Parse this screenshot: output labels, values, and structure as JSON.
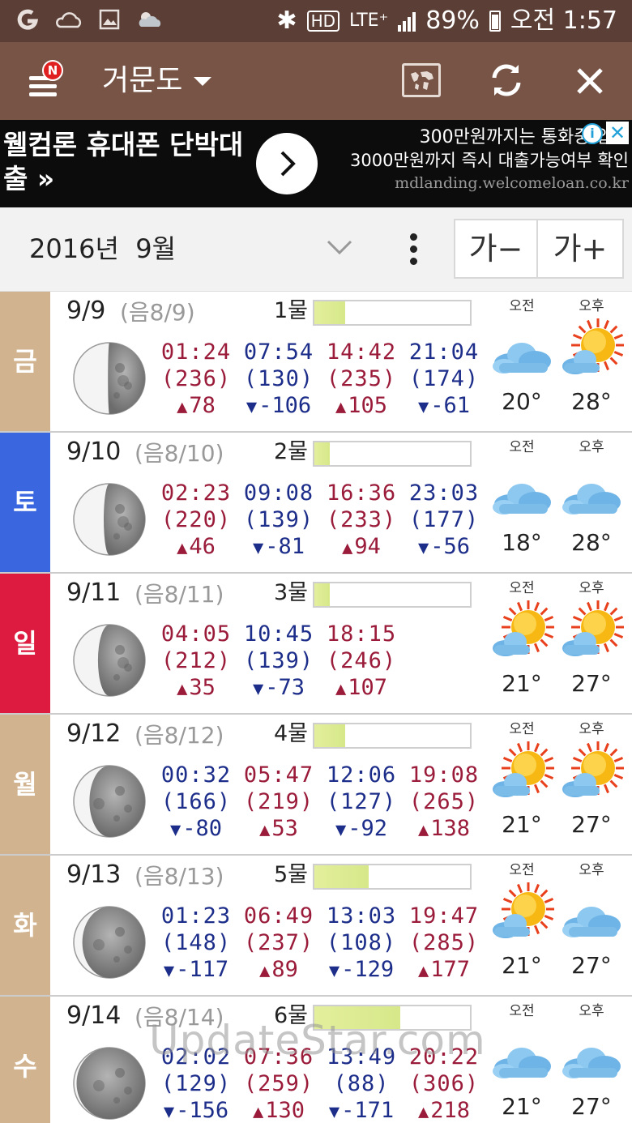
{
  "status_bar": {
    "left_icons": [
      "g-icon",
      "cloud-outline-icon",
      "image-icon",
      "weather-icon"
    ],
    "bluetooth": "✱",
    "hd": "HD",
    "network": "LTE⁺",
    "battery_percent": "89%",
    "time": "오전 1:57"
  },
  "app_bar": {
    "badge": "N",
    "location": "거문도"
  },
  "ad": {
    "left_text": "웰컴론 휴대폰 단박대출 »",
    "right_line1": "300만원까지는 통화중 입금",
    "right_line2": "3000만원까지 즉시 대출가능여부 확인",
    "right_url": "mdlanding.welcomeloan.co.kr",
    "info": "i",
    "close": "✕"
  },
  "month_bar": {
    "label": "2016년  9월",
    "font_minus": "가−",
    "font_plus": "가+"
  },
  "labels": {
    "am": "오전",
    "pm": "오후"
  },
  "colors": {
    "dow_weekday": "#d2b38f",
    "dow_saturday": "#3a67e0",
    "dow_sunday": "#dd1a3f",
    "high_tide": "#9a1c3a",
    "low_tide": "#1d2e8a"
  },
  "days": [
    {
      "dow": "금",
      "date": "9/9",
      "lunar": "(음8/9)",
      "mul": "1물",
      "tide_level": 0.2,
      "moon_phase": "waxing-crescent",
      "tides": [
        {
          "time": "01:24",
          "height": "(236)",
          "diff": "78",
          "type": "high"
        },
        {
          "time": "07:54",
          "height": "(130)",
          "diff": "-106",
          "type": "low"
        },
        {
          "time": "14:42",
          "height": "(235)",
          "diff": "105",
          "type": "high"
        },
        {
          "time": "21:04",
          "height": "(174)",
          "diff": "-61",
          "type": "low"
        }
      ],
      "am_weather": "cloudy-icon",
      "pm_weather": "sun-cloud-icon",
      "am_temp": "20°",
      "pm_temp": "28°"
    },
    {
      "dow": "토",
      "date": "9/10",
      "lunar": "(음8/10)",
      "mul": "2물",
      "tide_level": 0.1,
      "moon_phase": "first-quarter",
      "tides": [
        {
          "time": "02:23",
          "height": "(220)",
          "diff": "46",
          "type": "high"
        },
        {
          "time": "09:08",
          "height": "(139)",
          "diff": "-81",
          "type": "low"
        },
        {
          "time": "16:36",
          "height": "(233)",
          "diff": "94",
          "type": "high"
        },
        {
          "time": "23:03",
          "height": "(177)",
          "diff": "-56",
          "type": "low"
        }
      ],
      "am_weather": "cloudy-icon",
      "pm_weather": "cloudy-icon",
      "am_temp": "18°",
      "pm_temp": "28°"
    },
    {
      "dow": "일",
      "date": "9/11",
      "lunar": "(음8/11)",
      "mul": "3물",
      "tide_level": 0.1,
      "moon_phase": "waxing-gibbous-early",
      "tides": [
        {
          "time": "04:05",
          "height": "(212)",
          "diff": "35",
          "type": "high"
        },
        {
          "time": "10:45",
          "height": "(139)",
          "diff": "-73",
          "type": "low"
        },
        {
          "time": "18:15",
          "height": "(246)",
          "diff": "107",
          "type": "high"
        }
      ],
      "am_weather": "sun-cloud-icon",
      "pm_weather": "sun-cloud-icon",
      "am_temp": "21°",
      "pm_temp": "27°"
    },
    {
      "dow": "월",
      "date": "9/12",
      "lunar": "(음8/12)",
      "mul": "4물",
      "tide_level": 0.2,
      "moon_phase": "waxing-gibbous",
      "tides": [
        {
          "time": "00:32",
          "height": "(166)",
          "diff": "-80",
          "type": "low"
        },
        {
          "time": "05:47",
          "height": "(219)",
          "diff": "53",
          "type": "high"
        },
        {
          "time": "12:06",
          "height": "(127)",
          "diff": "-92",
          "type": "low"
        },
        {
          "time": "19:08",
          "height": "(265)",
          "diff": "138",
          "type": "high"
        }
      ],
      "am_weather": "sun-cloud-icon",
      "pm_weather": "sun-cloud-icon",
      "am_temp": "21°",
      "pm_temp": "27°"
    },
    {
      "dow": "화",
      "date": "9/13",
      "lunar": "(음8/13)",
      "mul": "5물",
      "tide_level": 0.35,
      "moon_phase": "waxing-gibbous-late",
      "tides": [
        {
          "time": "01:23",
          "height": "(148)",
          "diff": "-117",
          "type": "low"
        },
        {
          "time": "06:49",
          "height": "(237)",
          "diff": "89",
          "type": "high"
        },
        {
          "time": "13:03",
          "height": "(108)",
          "diff": "-129",
          "type": "low"
        },
        {
          "time": "19:47",
          "height": "(285)",
          "diff": "177",
          "type": "high"
        }
      ],
      "am_weather": "sun-cloud-icon",
      "pm_weather": "cloudy-icon",
      "am_temp": "21°",
      "pm_temp": "27°"
    },
    {
      "dow": "수",
      "date": "9/14",
      "lunar": "(음8/14)",
      "mul": "6물",
      "tide_level": 0.55,
      "moon_phase": "nearly-full",
      "tides": [
        {
          "time": "02:02",
          "height": "(129)",
          "diff": "-156",
          "type": "low"
        },
        {
          "time": "07:36",
          "height": "(259)",
          "diff": "130",
          "type": "high"
        },
        {
          "time": "13:49",
          "height": "(88)",
          "diff": "-171",
          "type": "low"
        },
        {
          "time": "20:22",
          "height": "(306)",
          "diff": "218",
          "type": "high"
        }
      ],
      "am_weather": "cloudy-icon",
      "pm_weather": "cloudy-icon",
      "am_temp": "21°",
      "pm_temp": "27°"
    }
  ],
  "watermark": "UpdateStar.com"
}
